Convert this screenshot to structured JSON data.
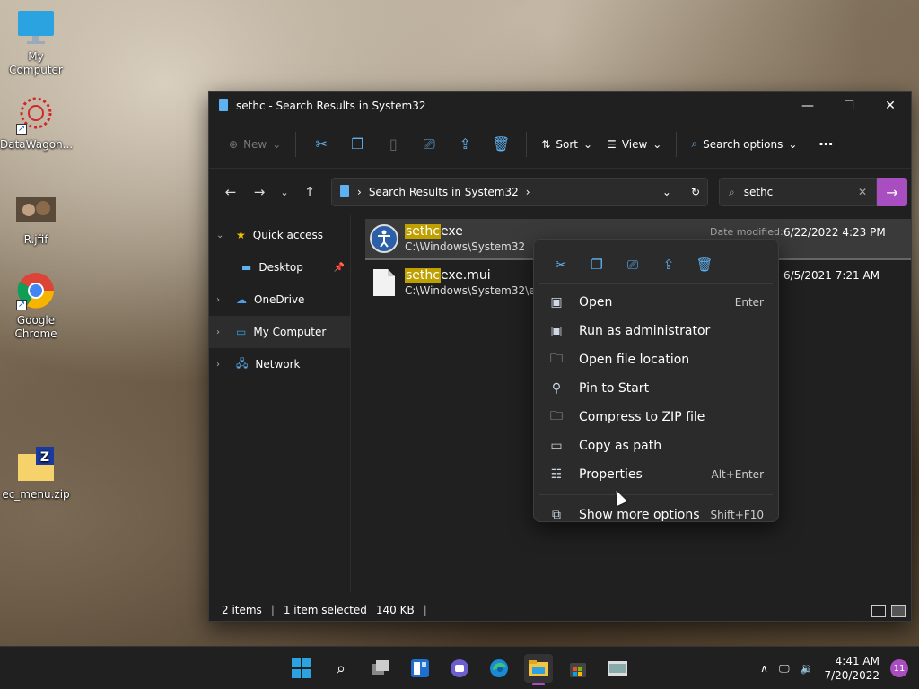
{
  "desktop": {
    "icons": [
      {
        "label": "My Computer",
        "icon": "monitor-icon"
      },
      {
        "label": "DataWagon...",
        "icon": "datawagon-icon"
      },
      {
        "label": "R.jfif",
        "icon": "image-file-icon"
      },
      {
        "label": "Google Chrome",
        "icon": "chrome-icon"
      },
      {
        "label": "ec_menu.zip",
        "icon": "zip-folder-icon"
      }
    ]
  },
  "window": {
    "title": "sethc - Search Results in System32",
    "toolbar": {
      "new_label": "New",
      "sort_label": "Sort",
      "view_label": "View",
      "search_options_label": "Search options"
    },
    "address": {
      "crumb": "Search Results in System32"
    },
    "search": {
      "value": "sethc"
    },
    "nav": [
      {
        "label": "Quick access",
        "icon": "star-icon"
      },
      {
        "label": "Desktop",
        "icon": "desktop-icon"
      },
      {
        "label": "OneDrive",
        "icon": "cloud-icon"
      },
      {
        "label": "My Computer",
        "icon": "monitor-icon"
      },
      {
        "label": "Network",
        "icon": "network-icon"
      }
    ],
    "files": [
      {
        "name_hl": "sethc",
        "name_rest": "exe",
        "path": "C:\\Windows\\System32",
        "date_label": "Date modified:",
        "date": "6/22/2022 4:23 PM"
      },
      {
        "name_hl": "sethc",
        "name_rest": "exe.mui",
        "path": "C:\\Windows\\System32\\en-U",
        "date": "6/5/2021 7:21 AM"
      }
    ],
    "status": {
      "items": "2 items",
      "selected": "1 item selected",
      "size": "140 KB"
    }
  },
  "context_menu": {
    "items": [
      {
        "label": "Open",
        "shortcut": "Enter",
        "icon": "open-icon"
      },
      {
        "label": "Run as administrator",
        "shortcut": "",
        "icon": "shield-icon"
      },
      {
        "label": "Open file location",
        "shortcut": "",
        "icon": "folder-icon"
      },
      {
        "label": "Pin to Start",
        "shortcut": "",
        "icon": "pin-icon"
      },
      {
        "label": "Compress to ZIP file",
        "shortcut": "",
        "icon": "zip-icon"
      },
      {
        "label": "Copy as path",
        "shortcut": "",
        "icon": "copy-path-icon"
      },
      {
        "label": "Properties",
        "shortcut": "Alt+Enter",
        "icon": "properties-icon"
      }
    ],
    "more": {
      "label": "Show more options",
      "shortcut": "Shift+F10"
    }
  },
  "taskbar": {
    "time": "4:41 AM",
    "date": "7/20/2022",
    "notification_count": "11"
  },
  "colors": {
    "accent": "#a84ec0",
    "highlight": "#c0a000",
    "icon_blue": "#5fb2f2"
  }
}
